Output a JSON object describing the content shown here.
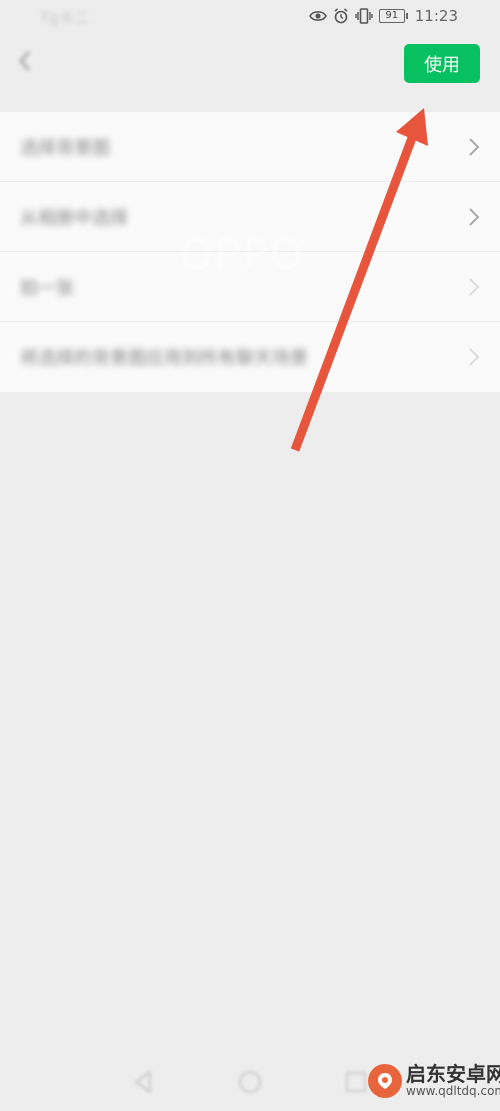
{
  "status_bar": {
    "carrier": "Tg卡二",
    "battery": "91",
    "time": "11:23",
    "icons": [
      "eye-icon",
      "alarm-icon",
      "vibrate-icon",
      "battery-icon"
    ]
  },
  "header": {
    "use_button": "使用"
  },
  "list": {
    "items": [
      {
        "label": "选择背景图"
      },
      {
        "label": "从相册中选择"
      },
      {
        "label": "拍一张"
      },
      {
        "label": "将选择的背景图应用到所有聊天场景"
      }
    ]
  },
  "watermark": {
    "text": "OPPO"
  },
  "bottom_nav": {
    "icons": [
      "back-triangle-icon",
      "home-circle-icon",
      "recent-square-icon"
    ]
  },
  "logo": {
    "title": "启东安卓网",
    "url": "www.qdltdq.com"
  },
  "colors": {
    "accent": "#07c160",
    "arrow": "#e8553d",
    "background": "#ededed"
  }
}
